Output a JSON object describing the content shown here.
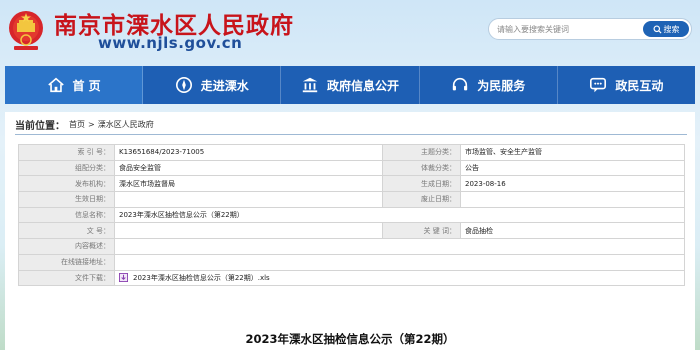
{
  "header": {
    "site_title": "南京市溧水区人民政府",
    "site_url": "www.njls.gov.cn",
    "search": {
      "placeholder": "请输入要搜索关键词",
      "button_label": "搜索"
    },
    "colors": {
      "title": "#c8141b",
      "url": "#1f4f9a",
      "nav": "#1e5fb4"
    }
  },
  "nav": {
    "items": [
      {
        "label": "首 页",
        "icon": "home-icon"
      },
      {
        "label": "走进溧水",
        "icon": "compass-icon"
      },
      {
        "label": "政府信息公开",
        "icon": "building-icon"
      },
      {
        "label": "为民服务",
        "icon": "headset-icon"
      },
      {
        "label": "政民互动",
        "icon": "chat-icon"
      }
    ]
  },
  "breadcrumb": {
    "label": "当前位置：",
    "items": [
      "首页",
      "溧水区人民政府"
    ],
    "separator": ">"
  },
  "info": {
    "index_no_label": "索 引 号：",
    "index_no": "K13651684/2023-71005",
    "topic_label": "主题分类：",
    "topic": "市场监管、安全生产监管",
    "org_category_label": "组配分类：",
    "org_category": "食品安全监管",
    "genre_label": "体裁分类：",
    "genre": "公告",
    "publisher_label": "发布机构：",
    "publisher": "溧水区市场监督局",
    "created_label": "生成日期：",
    "created": "2023-08-16",
    "effective_label": "生效日期：",
    "effective": "",
    "abolish_label": "废止日期：",
    "abolish": "",
    "name_label": "信息名称：",
    "name": "2023年溧水区抽检信息公示（第22期）",
    "doc_no_label": "文    号：",
    "doc_no": "",
    "keywords_label": "关 键 词：",
    "keywords": "食品抽检",
    "summary_label": "内容概述：",
    "summary": "",
    "online_label": "在线链接地址：",
    "online": "",
    "attachment_label": "文件下载：",
    "attachment": "2023年溧水区抽检信息公示（第22期）.xls"
  },
  "document": {
    "title": "2023年溧水区抽检信息公示（第22期）"
  }
}
